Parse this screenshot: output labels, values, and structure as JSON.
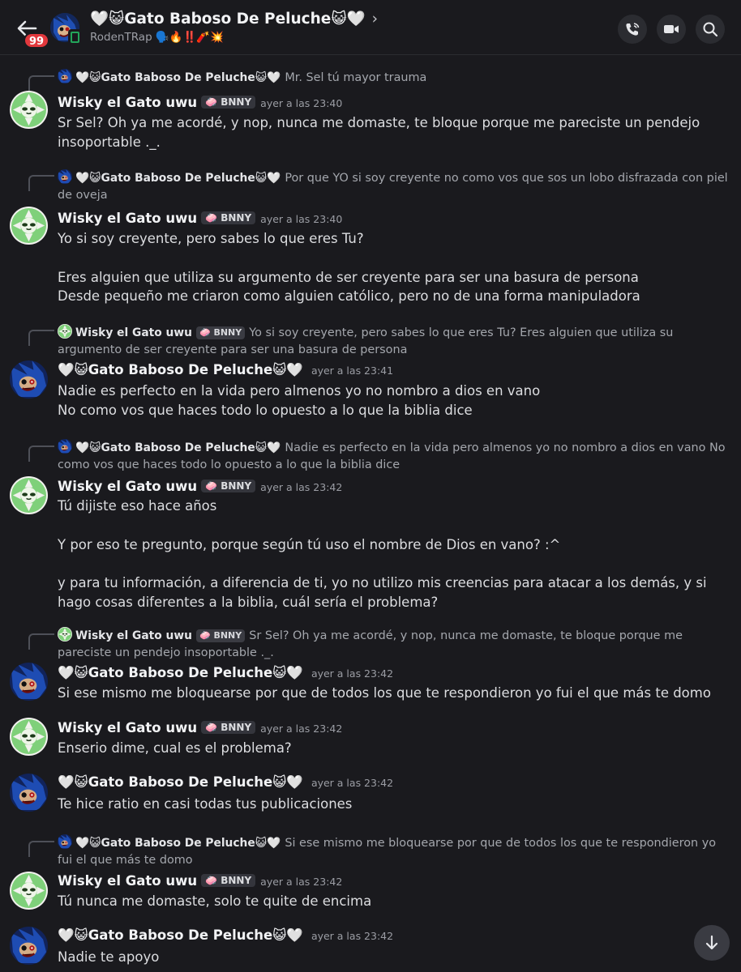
{
  "header": {
    "badge_count": "99",
    "title": "🤍😺Gato Baboso De Peluche😺🤍",
    "subtitle": "RodenTRap 🗣️🔥‼️🧨💥"
  },
  "users": {
    "wisky": {
      "name": "Wisky el Gato uwu",
      "tag": "🧼 BNNY"
    },
    "gato": {
      "name": "🤍😺Gato Baboso De Peluche😺🤍"
    }
  },
  "messages": [
    {
      "reply_name": "🤍😺Gato Baboso De Peluche😺🤍",
      "reply_tag": "",
      "reply_text": "Mr. Sel tú mayor trauma",
      "author": "Wisky el Gato uwu",
      "tag": "🧼 BNNY",
      "time": "ayer a las 23:40",
      "lines": [
        "Sr Sel? Oh ya me acordé, y nop, nunca me domaste, te bloque porque me pareciste un pendejo insoportable ._."
      ]
    },
    {
      "reply_name": "🤍😺Gato Baboso De Peluche😺🤍",
      "reply_tag": "",
      "reply_text": "Por que YO si soy creyente no como vos que sos un lobo disfrazada con piel de oveja",
      "author": "Wisky el Gato uwu",
      "tag": "🧼 BNNY",
      "time": "ayer a las 23:40",
      "lines": [
        "Yo si soy creyente, pero sabes lo que eres Tu?",
        "Eres alguien que utiliza su argumento de ser creyente para ser una basura de persona",
        "Desde pequeño me criaron como alguien católico, pero no de una forma manipuladora"
      ]
    },
    {
      "reply_name": "Wisky el Gato uwu",
      "reply_tag": "🧼 BNNY",
      "reply_text": "Yo si soy creyente, pero sabes lo que eres Tu?  Eres alguien que utiliza su argumento de ser creyente para ser una basura de persona",
      "author": "🤍😺Gato Baboso De Peluche😺🤍",
      "tag": "",
      "time": "ayer a las 23:41",
      "lines": [
        "Nadie es perfecto en la vida pero almenos yo no nombro a dios en vano",
        "No como vos que haces todo lo opuesto a lo que la biblia dice"
      ]
    },
    {
      "reply_name": "🤍😺Gato Baboso De Peluche😺🤍",
      "reply_tag": "",
      "reply_text": "Nadie es perfecto en la vida pero almenos yo no nombro a dios en vano No como vos que haces todo lo opuesto a lo que la biblia dice",
      "author": "Wisky el Gato uwu",
      "tag": "🧼 BNNY",
      "time": "ayer a las 23:42",
      "lines": [
        "Tú dijiste eso hace años",
        "Y por eso te pregunto, porque según tú uso el nombre de Dios en vano? :^",
        "y para tu información, a diferencia de ti, yo no utilizo mis creencias para atacar a los demás, y si hago cosas diferentes a la biblia, cuál sería el problema?"
      ]
    },
    {
      "reply_name": "Wisky el Gato uwu",
      "reply_tag": "🧼 BNNY",
      "reply_text": "Sr Sel? Oh ya me acordé, y nop, nunca me domaste, te bloque porque me pareciste un pendejo insoportable ._.",
      "author": "🤍😺Gato Baboso De Peluche😺🤍",
      "tag": "",
      "time": "ayer a las 23:42",
      "lines": [
        "Si ese mismo me bloquearse por que de todos los que te respondieron yo fui el que más te domo"
      ]
    },
    {
      "author": "Wisky el Gato uwu",
      "tag": "🧼 BNNY",
      "time": "ayer a las 23:42",
      "lines": [
        "Enserio dime, cual es el problema?"
      ]
    },
    {
      "author": "🤍😺Gato Baboso De Peluche😺🤍",
      "tag": "",
      "time": "ayer a las 23:42",
      "lines": [
        "Te hice ratio en casi todas tus publicaciones"
      ]
    },
    {
      "reply_name": "🤍😺Gato Baboso De Peluche😺🤍",
      "reply_tag": "",
      "reply_text": "Si ese mismo me bloquearse por que de todos los que te respondieron yo fui el que más te domo",
      "author": "Wisky el Gato uwu",
      "tag": "🧼 BNNY",
      "time": "ayer a las 23:42",
      "lines": [
        "Tú nunca me domaste, solo te quite de encima"
      ]
    },
    {
      "author": "🤍😺Gato Baboso De Peluche😺🤍",
      "tag": "",
      "time": "ayer a las 23:42",
      "lines": [
        "Nadie te apoyo"
      ]
    }
  ],
  "colors": {
    "background": "#1a1a1e",
    "badge": "#e2383d",
    "online": "#23a55a",
    "wisky_avatar": "#7fd07a"
  }
}
